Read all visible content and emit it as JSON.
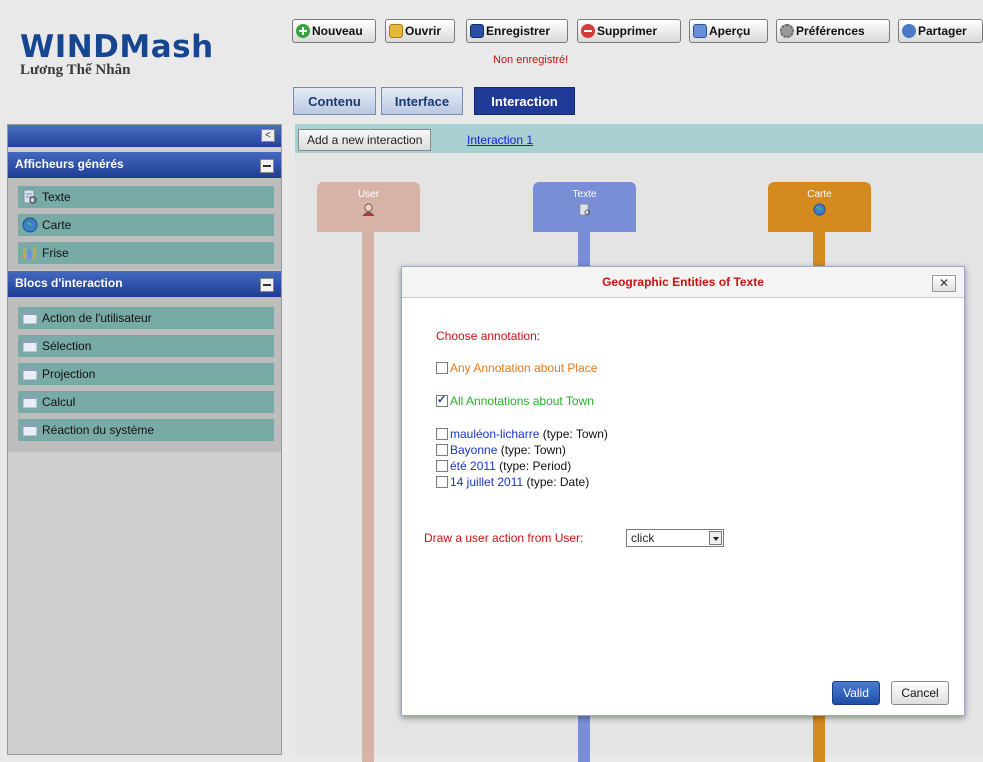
{
  "header": {
    "title": "WINDMash",
    "subtitle": "Lương Thế Nhân",
    "status": "Non enregistré!"
  },
  "toolbar": {
    "new_label": "Nouveau",
    "open_label": "Ouvrir",
    "save_label": "Enregistrer",
    "delete_label": "Supprimer",
    "preview_label": "Aperçu",
    "prefs_label": "Préférences",
    "share_label": "Partager"
  },
  "tabs": [
    {
      "label": "Contenu"
    },
    {
      "label": "Interface"
    },
    {
      "label": "Interaction"
    }
  ],
  "sidebar": {
    "collapse": "<",
    "sections": [
      {
        "title": "Afficheurs générés",
        "items": [
          {
            "label": "Texte",
            "icon": "text-doc-icon"
          },
          {
            "label": "Carte",
            "icon": "globe-icon"
          },
          {
            "label": "Frise",
            "icon": "timeline-icon"
          }
        ]
      },
      {
        "title": "Blocs d'interaction",
        "items": [
          {
            "label": "Action de l'utilisateur",
            "icon": "block-icon"
          },
          {
            "label": "Sélection",
            "icon": "block-icon"
          },
          {
            "label": "Projection",
            "icon": "block-icon"
          },
          {
            "label": "Calcul",
            "icon": "block-icon"
          },
          {
            "label": "Réaction du système",
            "icon": "block-icon"
          }
        ]
      }
    ]
  },
  "canvas": {
    "add_button": "Add a new interaction",
    "interaction_link": "Interaction 1",
    "lanes": [
      {
        "label": "User",
        "color": "#d6b3a6",
        "icon": "user-icon"
      },
      {
        "label": "Texte",
        "color": "#7a8ed8",
        "icon": "text-doc-icon"
      },
      {
        "label": "Carte",
        "color": "#d48a1f",
        "icon": "globe-icon"
      }
    ]
  },
  "dialog": {
    "title": "Geographic Entities of Texte",
    "close": "✕",
    "choose_label": "Choose annotation:",
    "any_place": "Any Annotation about Place",
    "any_place_checked": false,
    "all_town": "All Annotations about Town",
    "all_town_checked": true,
    "entities": [
      {
        "name": "mauléon-licharre",
        "type": "(type: Town)",
        "checked": false
      },
      {
        "name": "Bayonne",
        "type": "(type: Town)",
        "checked": false
      },
      {
        "name": "été 2011",
        "type": "(type: Period)",
        "checked": false
      },
      {
        "name": "14 juillet 2011",
        "type": "(type: Date)",
        "checked": false
      }
    ],
    "draw_label": "Draw a user action from User:",
    "action_value": "click",
    "valid_label": "Valid",
    "cancel_label": "Cancel"
  },
  "colors": {
    "brand": "#16468f",
    "accent": "#1f3b97",
    "error": "#cc1111",
    "orange_text": "#e87a1a",
    "green_text": "#22b322",
    "teal_item": "#79aba6"
  }
}
